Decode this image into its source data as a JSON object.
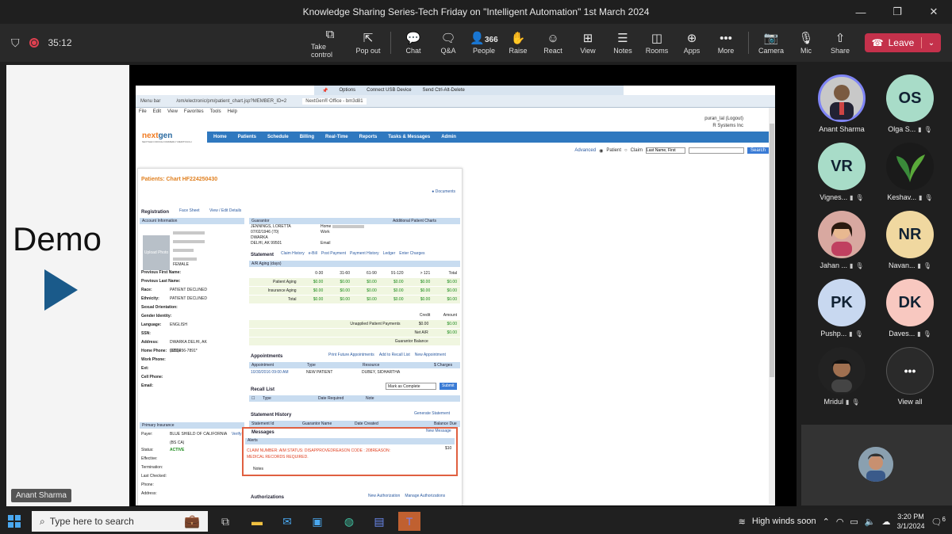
{
  "window": {
    "title": "Knowledge Sharing Series-Tech Friday on \"Intelligent Automation\" 1st March 2024"
  },
  "toolbar": {
    "timer": "35:12",
    "buttons": [
      {
        "label": "Take control",
        "icon": "take-control-icon"
      },
      {
        "label": "Pop out",
        "icon": "pop-out-icon"
      },
      {
        "label": "Chat",
        "icon": "chat-icon"
      },
      {
        "label": "Q&A",
        "icon": "qa-icon"
      },
      {
        "label": "People",
        "icon": "people-icon",
        "count": "366"
      },
      {
        "label": "Raise",
        "icon": "raise-hand-icon"
      },
      {
        "label": "React",
        "icon": "react-icon"
      },
      {
        "label": "View",
        "icon": "view-icon"
      },
      {
        "label": "Notes",
        "icon": "notes-icon"
      },
      {
        "label": "Rooms",
        "icon": "rooms-icon"
      },
      {
        "label": "Apps",
        "icon": "apps-icon"
      },
      {
        "label": "More",
        "icon": "more-icon"
      },
      {
        "label": "Camera",
        "icon": "camera-off-icon"
      },
      {
        "label": "Mic",
        "icon": "mic-off-icon"
      },
      {
        "label": "Share",
        "icon": "share-icon"
      }
    ],
    "leave_label": "Leave",
    "leave_color": "#c4314b"
  },
  "stage": {
    "demo_text": "Demo",
    "presenter_name": "Anant Sharma"
  },
  "app": {
    "rdp_bar": {
      "options": "Options",
      "usb": "Connect USB Device",
      "ctrl": "Send Ctrl-Alt-Delete"
    },
    "address": {
      "menu_bar": "Menu bar",
      "url": "/om/electronic/pm/patient_chart.jsp?MEMBER_ID=2",
      "tab": "NextGen® Office - bm3d81"
    },
    "menu": [
      "File",
      "Edit",
      "View",
      "Favorites",
      "Tools",
      "Help"
    ],
    "user_line": "puran_lal (Logout)",
    "company": "R Systems Inc",
    "logo": {
      "a": "next",
      "b": "gen",
      "sub": "NEXTGEN OFFICE FORMERLY MEDITOUCH"
    },
    "nav": [
      "Home",
      "Patients",
      "Schedule",
      "Billing",
      "Real-Time",
      "Reports",
      "Tasks & Messages",
      "Admin"
    ],
    "search": {
      "advanced": "Advanced",
      "patient": "Patient",
      "claim": "Claim",
      "field": "Last Name, First",
      "button": "Search"
    },
    "chart_title": "Patients: Chart HF224250430",
    "documents": "Documents",
    "registration": {
      "title": "Registration",
      "face_sheet": "Face Sheet",
      "view_edit": "View / Edit Details",
      "account_info": "Account Information"
    },
    "patient": {
      "upload_photo": "Upload Photo",
      "sex": "FEMALE",
      "fields": [
        {
          "label": "Previous First Name:",
          "value": ""
        },
        {
          "label": "Previous Last Name:",
          "value": ""
        },
        {
          "label": "Race:",
          "value": "PATIENT DECLINED"
        },
        {
          "label": "Ethnicity:",
          "value": "PATIENT DECLINED"
        },
        {
          "label": "Sexual Orientation:",
          "value": ""
        },
        {
          "label": "Gender Identity:",
          "value": ""
        },
        {
          "label": "Language:",
          "value": "ENGLISH"
        },
        {
          "label": "SSN:",
          "value": ""
        },
        {
          "label": "Address:",
          "value": "DWARKA DELHI, AK 99501"
        },
        {
          "label": "Home Phone:",
          "value": "(123)456-7891*"
        },
        {
          "label": "Work Phone:",
          "value": ""
        },
        {
          "label": "Ext:",
          "value": ""
        },
        {
          "label": "Cell Phone:",
          "value": ""
        },
        {
          "label": "Email:",
          "value": ""
        }
      ],
      "primary_insurance": "Primary Insurance",
      "payer_label": "Payer:",
      "payer": "BLUE SHIELD OF CALIFORNIA (BS CA)",
      "verify": "Verify",
      "status_label": "Status:",
      "status": "ACTIVE",
      "effective": "Effective:",
      "termination": "Termination:",
      "last_checked": "Last Checked:",
      "phone": "Phone:",
      "address2": "Address:"
    },
    "guarantor": {
      "title": "Guarantor",
      "additional": "Additional Patient Charts",
      "name": "JENNINGS, LORETTA",
      "dob": "07/02/1946 (70)",
      "addr1": "DWARKA",
      "addr2": "DELHI, AK 99501",
      "home": "Home",
      "work": "Work",
      "email": "Email"
    },
    "statement": {
      "title": "Statement",
      "links": [
        "Claim History",
        "e-Bill",
        "Post Payment",
        "Payment History",
        "Ledger",
        "Enter Charges"
      ],
      "aging_header": "A/R Aging (days)",
      "cols": [
        "0-30",
        "31-60",
        "61-90",
        "91-120",
        "> 121",
        "Total"
      ],
      "rows": [
        {
          "label": "Patient Aging",
          "vals": [
            "$0.00",
            "$0.00",
            "$0.00",
            "$0.00",
            "$0.00",
            "$0.00"
          ]
        },
        {
          "label": "Insurance Aging",
          "vals": [
            "$0.00",
            "$0.00",
            "$0.00",
            "$0.00",
            "$0.00",
            "$0.00"
          ]
        },
        {
          "label": "Total",
          "vals": [
            "$0.00",
            "$0.00",
            "$0.00",
            "$0.00",
            "$0.00",
            "$0.00"
          ]
        }
      ],
      "credit": "Credit",
      "amount": "Amount",
      "unapplied": "Unapplied Patient Payments",
      "unapplied_credit": "$0.00",
      "unapplied_amount": "$0.00",
      "net_ar": "Net A/R",
      "net_ar_amount": "$0.00",
      "guarantor_balance": "Guarantor Balance"
    },
    "appointments": {
      "title": "Appointments",
      "print": "Print Future Appointments",
      "recall": "Add to Recall List",
      "new": "New Appointment",
      "cols": [
        "Appointment",
        "Type",
        "Resource",
        "$ Charges"
      ],
      "row": [
        "10/30/2016 09:00 AM",
        "NEW PATIENT",
        "DUBEY, SIDHARTHA",
        ""
      ]
    },
    "recall": {
      "title": "Recall List",
      "select": "Mark as Complete",
      "submit": "Submit",
      "cols": [
        "Type",
        "Date Required",
        "Note"
      ]
    },
    "statement_history": {
      "title": "Statement History",
      "generate": "Generate Statement",
      "cols": [
        "Statement Id",
        "Guarantor Name",
        "Date Created",
        "Balance Due"
      ]
    },
    "messages": {
      "title": "Messages",
      "new": "New Message",
      "alerts": "Alerts",
      "line1": "CLAIM NUMBER:                    AIM STATUS: DISAPPROVEDREASON CODE : 208REASON:",
      "line2": "MEDICAL RECORDS REQUIRED.",
      "amount": "$10",
      "notes": "Notes"
    },
    "authorizations": {
      "title": "Authorizations",
      "new": "New Authorization",
      "manage": "Manage Authorizations"
    }
  },
  "participants": [
    {
      "name": "Anant Sharma",
      "initials": "",
      "bg": "#c8c8c8",
      "ring": true
    },
    {
      "name": "Olga S...",
      "initials": "OS",
      "bg": "#a8dcc8"
    },
    {
      "name": "Vignes...",
      "initials": "VR",
      "bg": "#a8dcc8"
    },
    {
      "name": "Keshav...",
      "initials": "",
      "bg": "#1a1a1a"
    },
    {
      "name": "Jahan ...",
      "initials": "",
      "bg": "#d8a8a0"
    },
    {
      "name": "Navan...",
      "initials": "NR",
      "bg": "#f0d8a0"
    },
    {
      "name": "Pushp...",
      "initials": "PK",
      "bg": "#c8d8f0"
    },
    {
      "name": "Daves...",
      "initials": "DK",
      "bg": "#f8c8c0"
    },
    {
      "name": "Mridul",
      "initials": "",
      "bg": "#222222"
    },
    {
      "name": "View all",
      "initials": "•••",
      "bg": "#2a2a2a"
    }
  ],
  "taskbar": {
    "search_placeholder": "Type here to search",
    "weather": "High winds soon",
    "time": "3:20 PM",
    "date": "3/1/2024",
    "notifications": "6"
  }
}
